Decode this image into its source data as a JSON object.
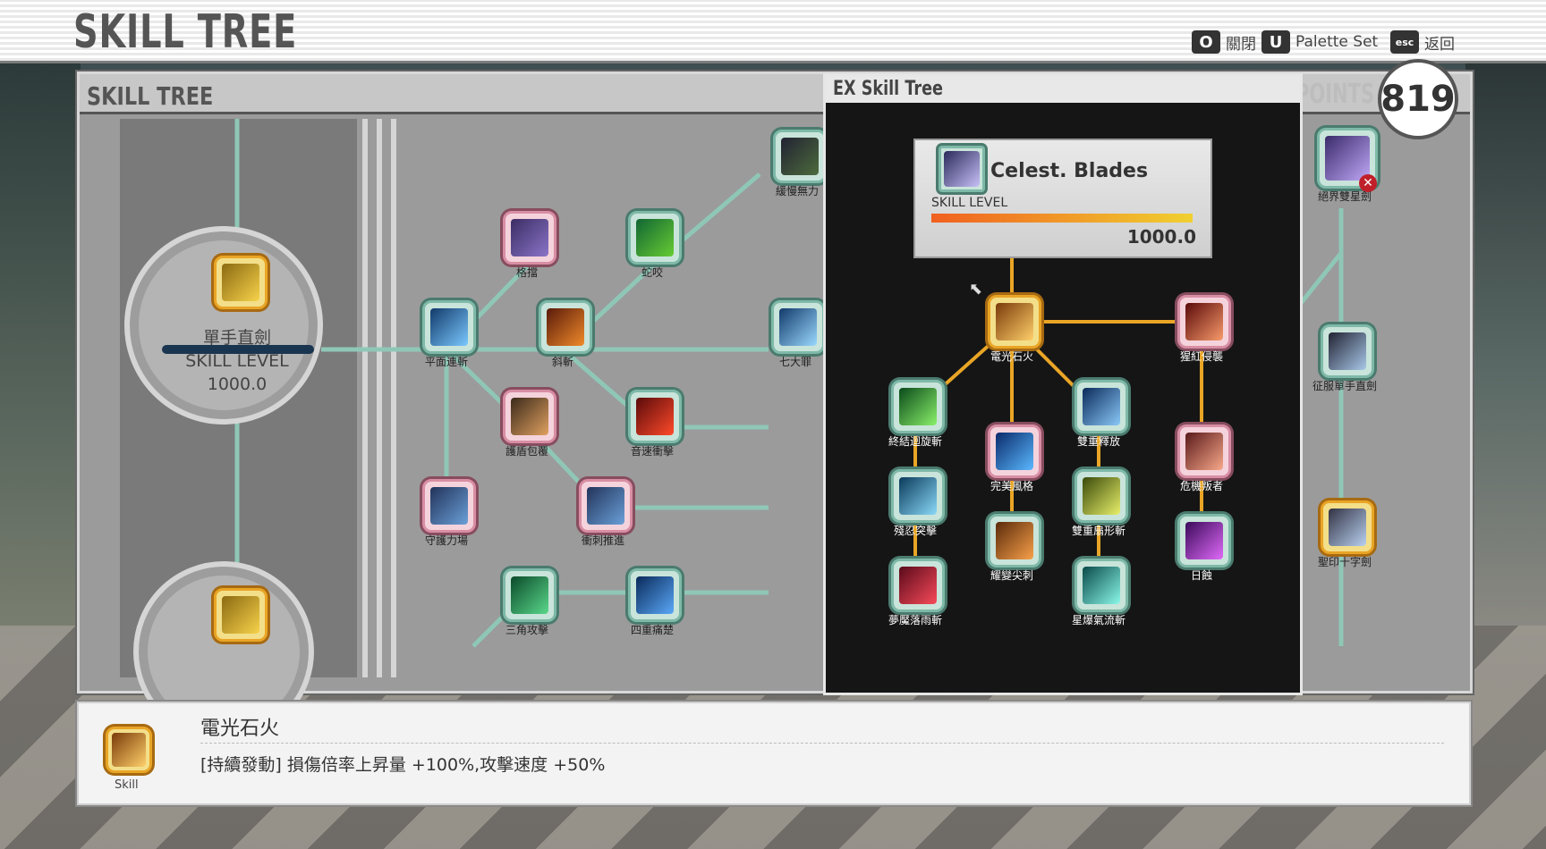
{
  "header": {
    "title": "SKILL TREE",
    "hints": [
      {
        "key": "O",
        "label": "關閉"
      },
      {
        "key": "U",
        "label": "Palette Set"
      },
      {
        "key": "esc",
        "label": "返回"
      }
    ]
  },
  "panel": {
    "title": "SKILL TREE",
    "points_label": "POINTS",
    "points": "819"
  },
  "weapon": {
    "name": "單手直劍",
    "level_label": "SKILL LEVEL",
    "level": "1000.0"
  },
  "ex": {
    "title": "EX Skill Tree",
    "card": {
      "name": "Celest. Blades",
      "level_label": "SKILL LEVEL",
      "level": "1000.0",
      "progress": 1.0
    }
  },
  "nodes_main": [
    {
      "label": "緩慢無力"
    },
    {
      "label": "格擋"
    },
    {
      "label": "蛇咬"
    },
    {
      "label": "平面連斬"
    },
    {
      "label": "斜斬"
    },
    {
      "label": "七大罪"
    },
    {
      "label": "護盾包覆"
    },
    {
      "label": "音速衝擊"
    },
    {
      "label": "守護力場"
    },
    {
      "label": "衝刺推進"
    },
    {
      "label": "三角攻擊"
    },
    {
      "label": "四重痛楚"
    }
  ],
  "nodes_ex": [
    {
      "label": "電光石火"
    },
    {
      "label": "猩紅侵襲"
    },
    {
      "label": "終結迴旋斬"
    },
    {
      "label": "雙重釋放"
    },
    {
      "label": "完美風格"
    },
    {
      "label": "危機叛者"
    },
    {
      "label": "殘忍突擊"
    },
    {
      "label": "雙重扇形斬"
    },
    {
      "label": "耀變尖刺"
    },
    {
      "label": "日蝕"
    },
    {
      "label": "夢魘落雨斬"
    },
    {
      "label": "星爆氣流斬"
    }
  ],
  "nodes_right": [
    {
      "label": "絕界雙星劍"
    },
    {
      "label": "征服單手直劍"
    },
    {
      "label": "聖印十字劍"
    }
  ],
  "detail": {
    "name": "電光石火",
    "icon_label": "Skill",
    "effect": "[持續發動] 損傷倍率上昇量 +100%,攻擊速度 +50%"
  },
  "colors": {
    "gold": "#e9a526",
    "teal": "#7fb9a8",
    "accent_bar": "#f0a020"
  }
}
